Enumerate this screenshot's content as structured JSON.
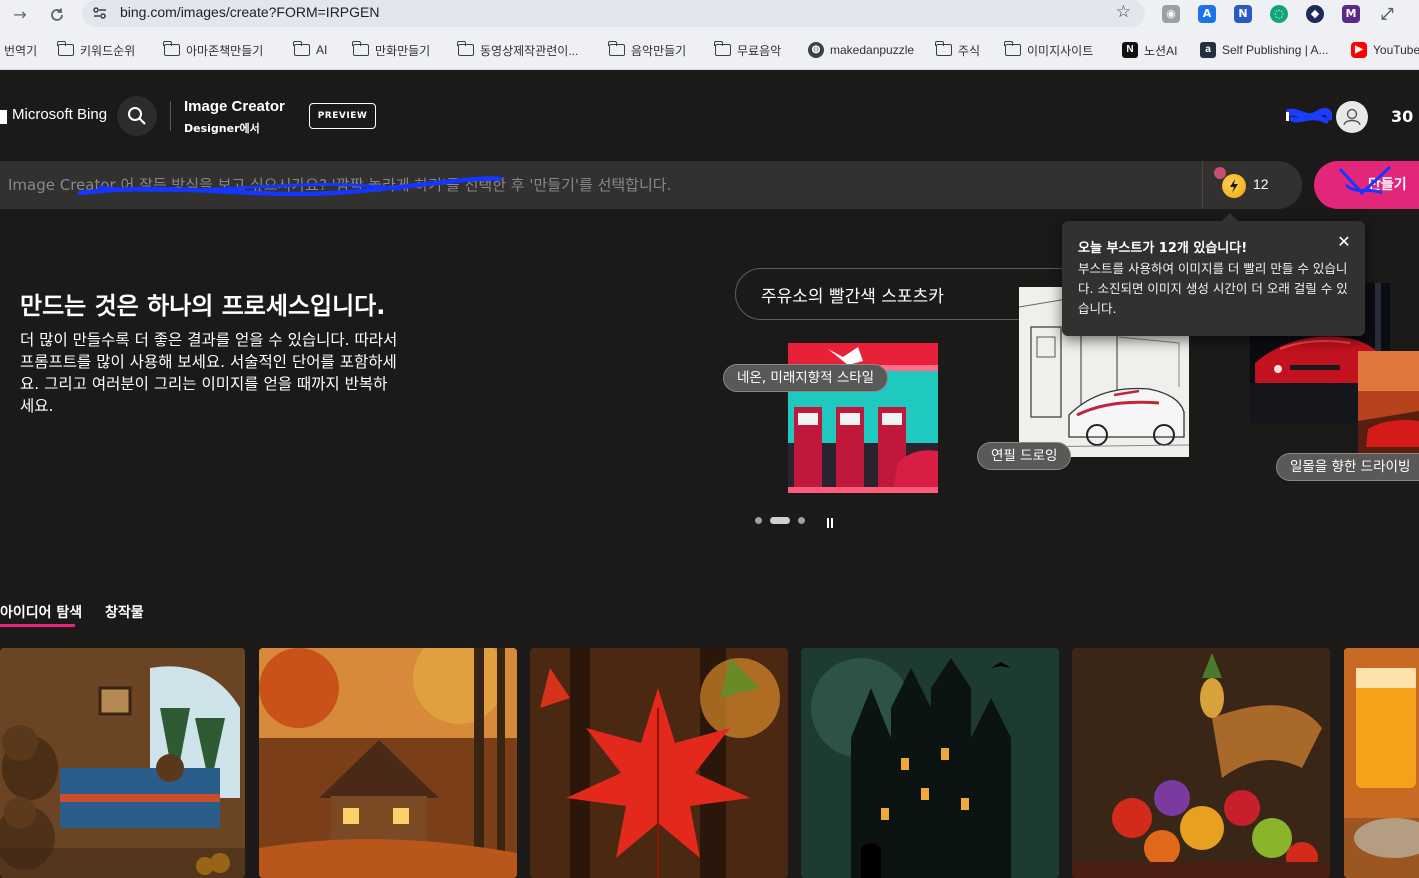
{
  "browser": {
    "url": "bing.com/images/create?FORM=IRPGEN",
    "bookmarks": [
      {
        "label": "번역기",
        "type": "none"
      },
      {
        "label": "키워드순위",
        "type": "folder"
      },
      {
        "label": "아마존책만들기",
        "type": "folder"
      },
      {
        "label": "AI",
        "type": "folder"
      },
      {
        "label": "만화만들기",
        "type": "folder"
      },
      {
        "label": "동영상제작관련이...",
        "type": "folder"
      },
      {
        "label": "음악만들기",
        "type": "folder"
      },
      {
        "label": "무료음악",
        "type": "folder"
      },
      {
        "label": "makedanpuzzle",
        "type": "globe"
      },
      {
        "label": "주식",
        "type": "folder"
      },
      {
        "label": "이미지사이트",
        "type": "folder"
      },
      {
        "label": "노션AI",
        "type": "notion"
      },
      {
        "label": "Self Publishing | A...",
        "type": "amazon"
      },
      {
        "label": "YouTube",
        "type": "youtube"
      }
    ]
  },
  "header": {
    "brand": "Microsoft Bing",
    "product_title": "Image Creator",
    "product_sub": "Designer에서",
    "preview_label": "PREVIEW",
    "reward_count": "30"
  },
  "prompt": {
    "placeholder": "Image Creator 어 잘든 방식을 보고 싶으시가요? '깜짝 놀라게 하기'를 선택한 후 '만들기'를 선택합니다.",
    "boost_count": "12",
    "create_label": "만들기"
  },
  "hero": {
    "title": "만드는 것은 하나의 프로세스입니다.",
    "description": "더 많이 만들수록 더 좋은 결과를 얻을 수 있습니다. 따라서 프롬프트를 많이 사용해 보세요. 서술적인 단어를 포함하세요. 그리고 여러분이 그리는 이미지를 얻을 때까지 반복하세요.",
    "carousel_prompt": "주유소의 빨간색 스포츠카",
    "chips": [
      "네온, 미래지향적 스타일",
      "연필 드로잉",
      "일몰을 향한 드라이빙"
    ]
  },
  "tooltip": {
    "title": "오늘 부스트가 12개 있습니다!",
    "body": "부스트를 사용하여 이미지를 더 빨리 만들 수 있습니다. 소진되면 이미지 생성 시간이 더 오래 걸릴 수 있습니다."
  },
  "tabs": [
    {
      "label": "아이디어 탐색",
      "active": true
    },
    {
      "label": "창작물",
      "active": false
    }
  ],
  "colors": {
    "accent": "#e3267a",
    "background": "#1b1a19",
    "surface": "#323130"
  }
}
